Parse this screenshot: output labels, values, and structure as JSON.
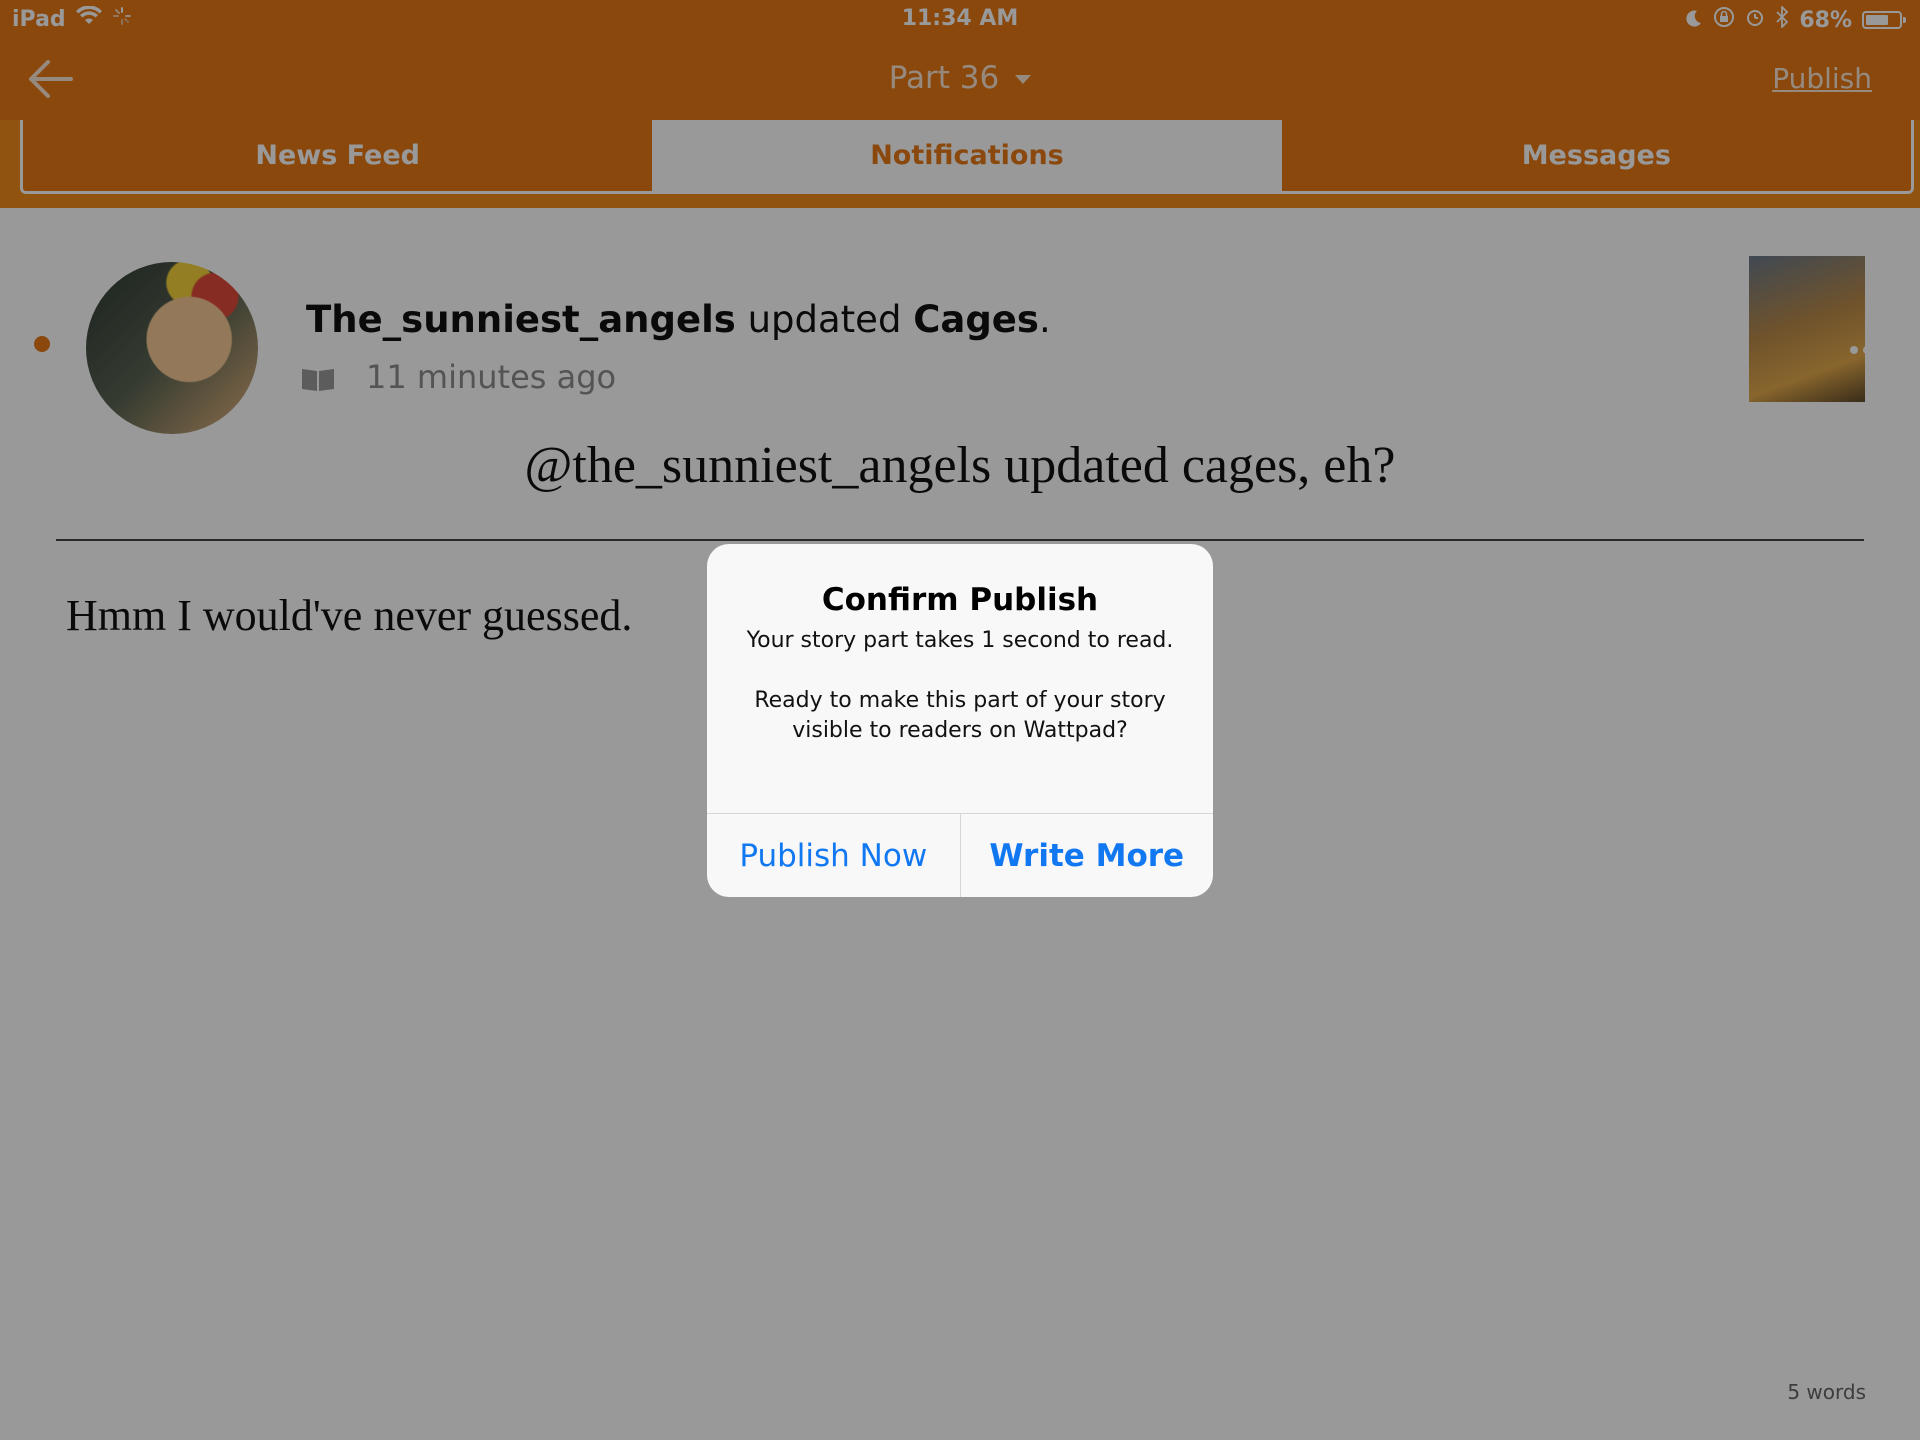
{
  "status_bar": {
    "device": "iPad",
    "time": "11:34 AM",
    "battery_percent": "68%",
    "battery_level": 0.68
  },
  "nav": {
    "title": "Part 36",
    "publish_label": "Publish"
  },
  "background_notifications": {
    "tabs": [
      "News Feed",
      "Notifications",
      "Messages"
    ],
    "active_tab": "Notifications",
    "notification": {
      "user": "The_sunniest_angels",
      "action": "updated",
      "story": "Cages",
      "time_ago": "11 minutes ago"
    }
  },
  "editor": {
    "title": "@the_sunniest_angels updated cages, eh?",
    "body": "Hmm I would've never guessed.",
    "word_count": "5 words"
  },
  "alert": {
    "title": "Confirm Publish",
    "message_line1": "Your story part takes 1 second to read.",
    "message_line2": "Ready to make this part of your story visible to readers on Wattpad?",
    "publish_now_label": "Publish Now",
    "write_more_label": "Write More"
  },
  "colors": {
    "brand_orange": "#E67817",
    "ios_blue": "#1278F2"
  }
}
